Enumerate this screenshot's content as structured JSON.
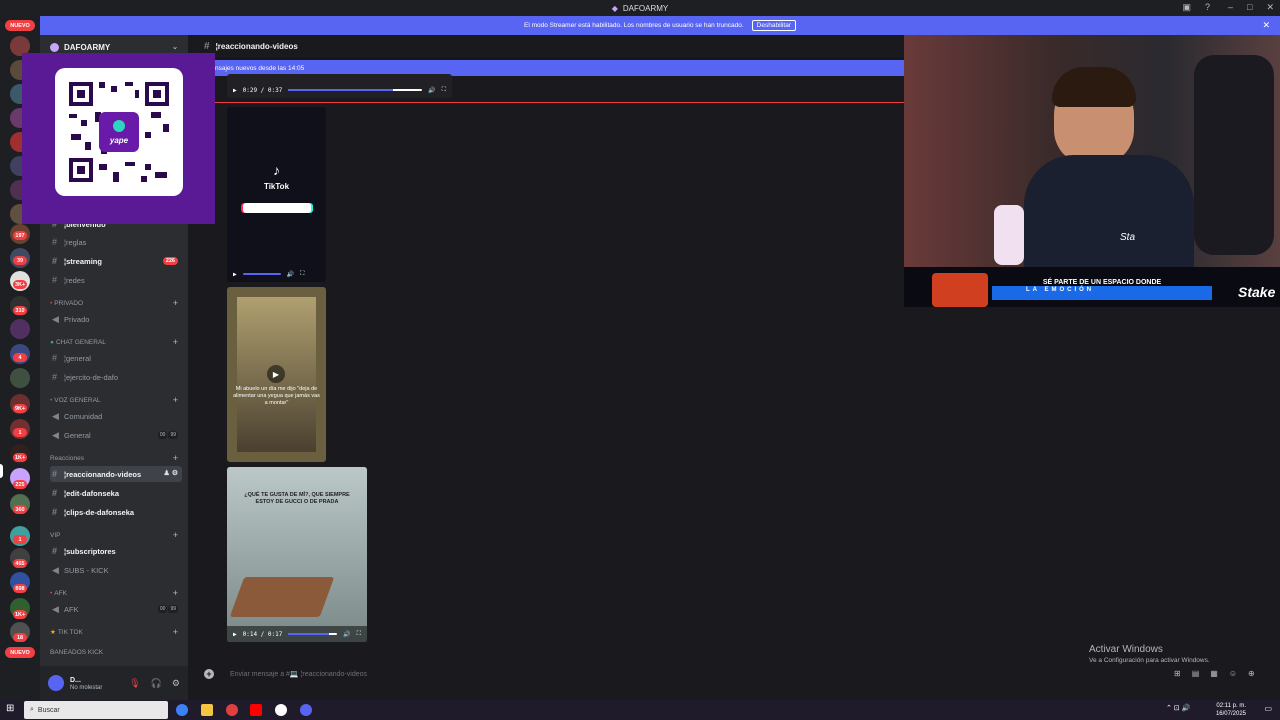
{
  "window": {
    "title": "DAFOARMY"
  },
  "streamer_bar": {
    "text": "El modo Streamer está habilitado. Los nombres de usuario se han truncado.",
    "button": "Deshabilitar"
  },
  "rail": {
    "nuevo_top": "NUEVO",
    "nuevo_bottom": "NUEVO",
    "badges": [
      "197",
      "39",
      "3K+",
      "310",
      "4",
      "9K+",
      "1",
      "1K+",
      "225",
      "360",
      "1",
      "465",
      "898",
      "1K+",
      "18"
    ]
  },
  "guild": {
    "name": "DAFOARMY"
  },
  "channels": {
    "bienvenido": "¦bienvenido",
    "reglas": "¦reglas",
    "streaming": "¦streaming",
    "streaming_count": "226",
    "redes": "¦redes",
    "cat_privado": "PRIVADO",
    "privado": "Privado",
    "cat_chat": "CHAT GENERAL",
    "general_text": "¦general",
    "ejercito": "¦ejercito-de-dafo",
    "cat_voz": "VOZ GENERAL",
    "comunidad": "Comunidad",
    "general_voice": "General",
    "general_voice_a": "00",
    "general_voice_b": "99",
    "cat_reacciones": "Reacciones",
    "reaccionando": "¦reaccionando-videos",
    "edit": "¦edit-dafonseka",
    "clips": "¦clips-de-dafonseka",
    "cat_vip": "VIP",
    "subscriptores": "¦subscriptores",
    "subs_kick": "SUBS - KICK",
    "cat_afk": "AFK",
    "afk": "AFK",
    "afk_a": "00",
    "afk_b": "99",
    "cat_tiktok": "TIK TOK",
    "cat_baneados": "BANEADOS KICK"
  },
  "user": {
    "name": "D...",
    "status": "No molestar"
  },
  "header": {
    "channel": "¦reaccionando-videos"
  },
  "new_messages": {
    "text": "nsajes nuevos desde las 14:05"
  },
  "videos": [
    {
      "time": "0:29 / 0:37",
      "progress": 0.78
    },
    {
      "label": "TikTok"
    },
    {
      "caption": "Mi abuelo un día me dijo \"deja de alimentar una yegua que jamás vas a montar\""
    },
    {
      "caption": "¿QUÉ TE GUSTA DE MÍ?, QUE SIEMPRE ESTOY DE GUCCI O DE PRADA",
      "time": "0:14 / 0:17",
      "progress": 0.82
    }
  ],
  "composer": {
    "placeholder": "Enviar mensaje a #💻 ¦reaccionando-videos"
  },
  "overlay": {
    "qr_label": "yape",
    "banner_line1": "SÉ PARTE DE UN ESPACIO DONDE",
    "banner_line2": "LA EMOCIÓN",
    "brand": "Stake",
    "hoodie": "Sta"
  },
  "activate_windows": {
    "title": "Activar Windows",
    "subtitle": "Ve a Configuración para activar Windows."
  },
  "taskbar": {
    "search": "Buscar",
    "time": "02:11 p. m.",
    "date": "16/07/2025"
  },
  "colors": {
    "blurple": "#5865f2",
    "red": "#f23f43",
    "sidebar": "#2b2d31",
    "rail": "#1e1f22"
  }
}
